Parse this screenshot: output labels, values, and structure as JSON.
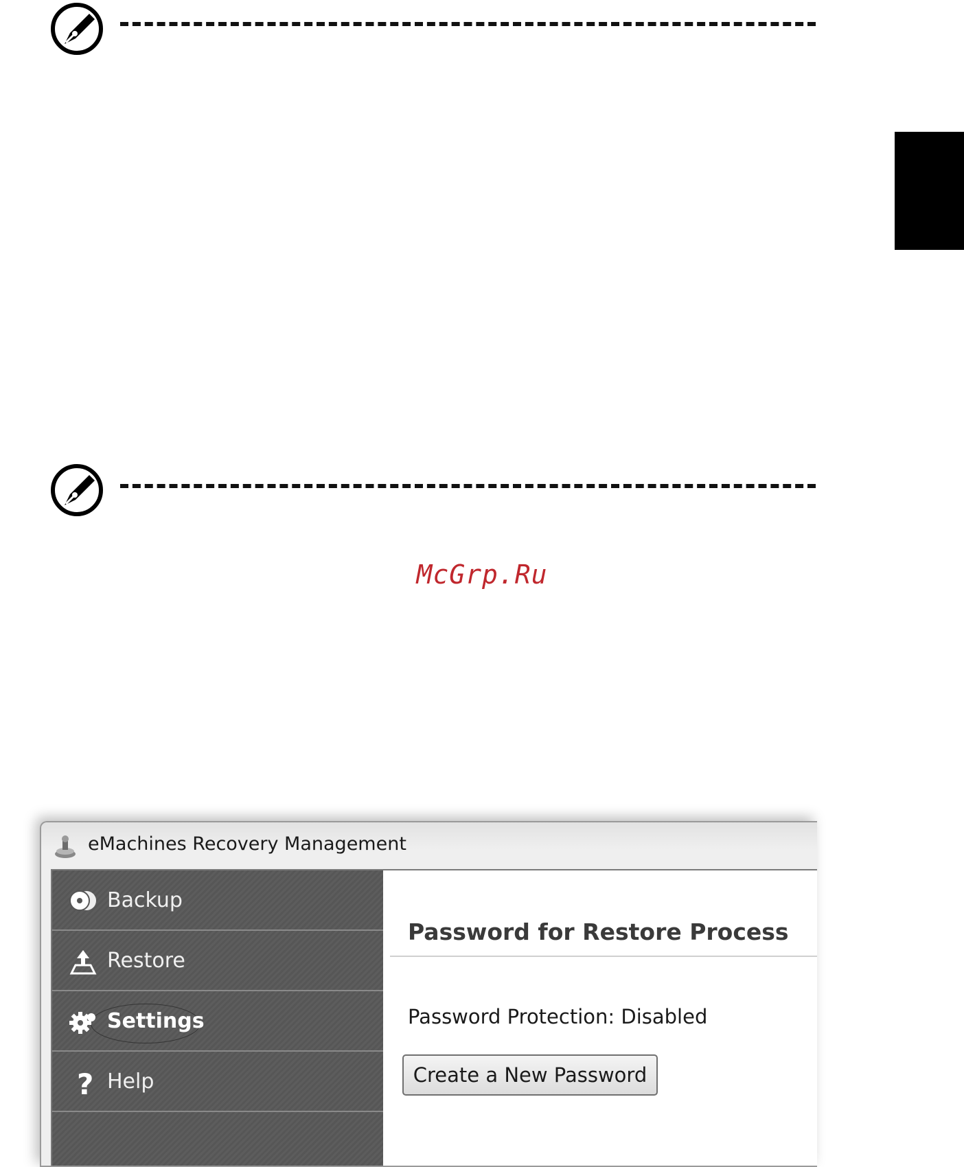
{
  "watermark": "McGrp.Ru",
  "app": {
    "title": "eMachines Recovery Management",
    "nav_items": [
      {
        "label": "Backup",
        "icon": "disc-icon"
      },
      {
        "label": "Restore",
        "icon": "restore-icon"
      },
      {
        "label": "Settings",
        "icon": "gear-icon",
        "active": true
      },
      {
        "label": "Help",
        "icon": "help-icon"
      }
    ],
    "content": {
      "heading": "Password for Restore Process",
      "status": "Password Protection: Disabled",
      "button_label": "Create a New Password"
    }
  }
}
